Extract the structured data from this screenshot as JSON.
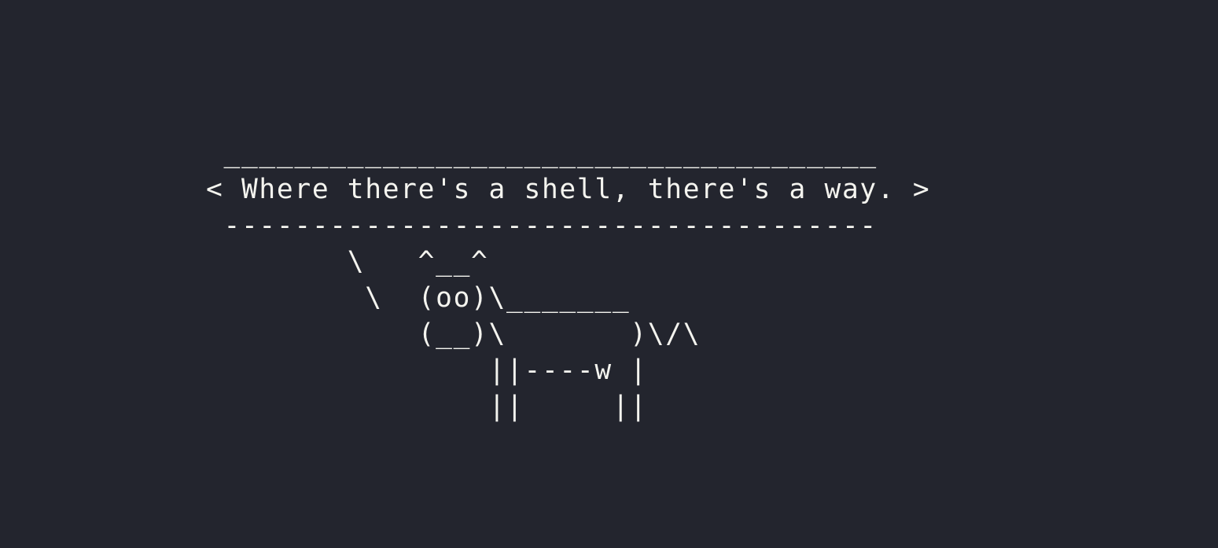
{
  "terminal": {
    "background": "#23252e",
    "foreground": "#f4f4ef",
    "cowsay": {
      "message": "Where there's a shell, there's a way.",
      "lines": [
        " _____________________________________",
        "< Where there's a shell, there's a way. >",
        " -------------------------------------",
        "        \\   ^__^",
        "         \\  (oo)\\_______",
        "            (__)\\       )\\/\\",
        "                ||----w |",
        "                ||     ||"
      ]
    }
  }
}
